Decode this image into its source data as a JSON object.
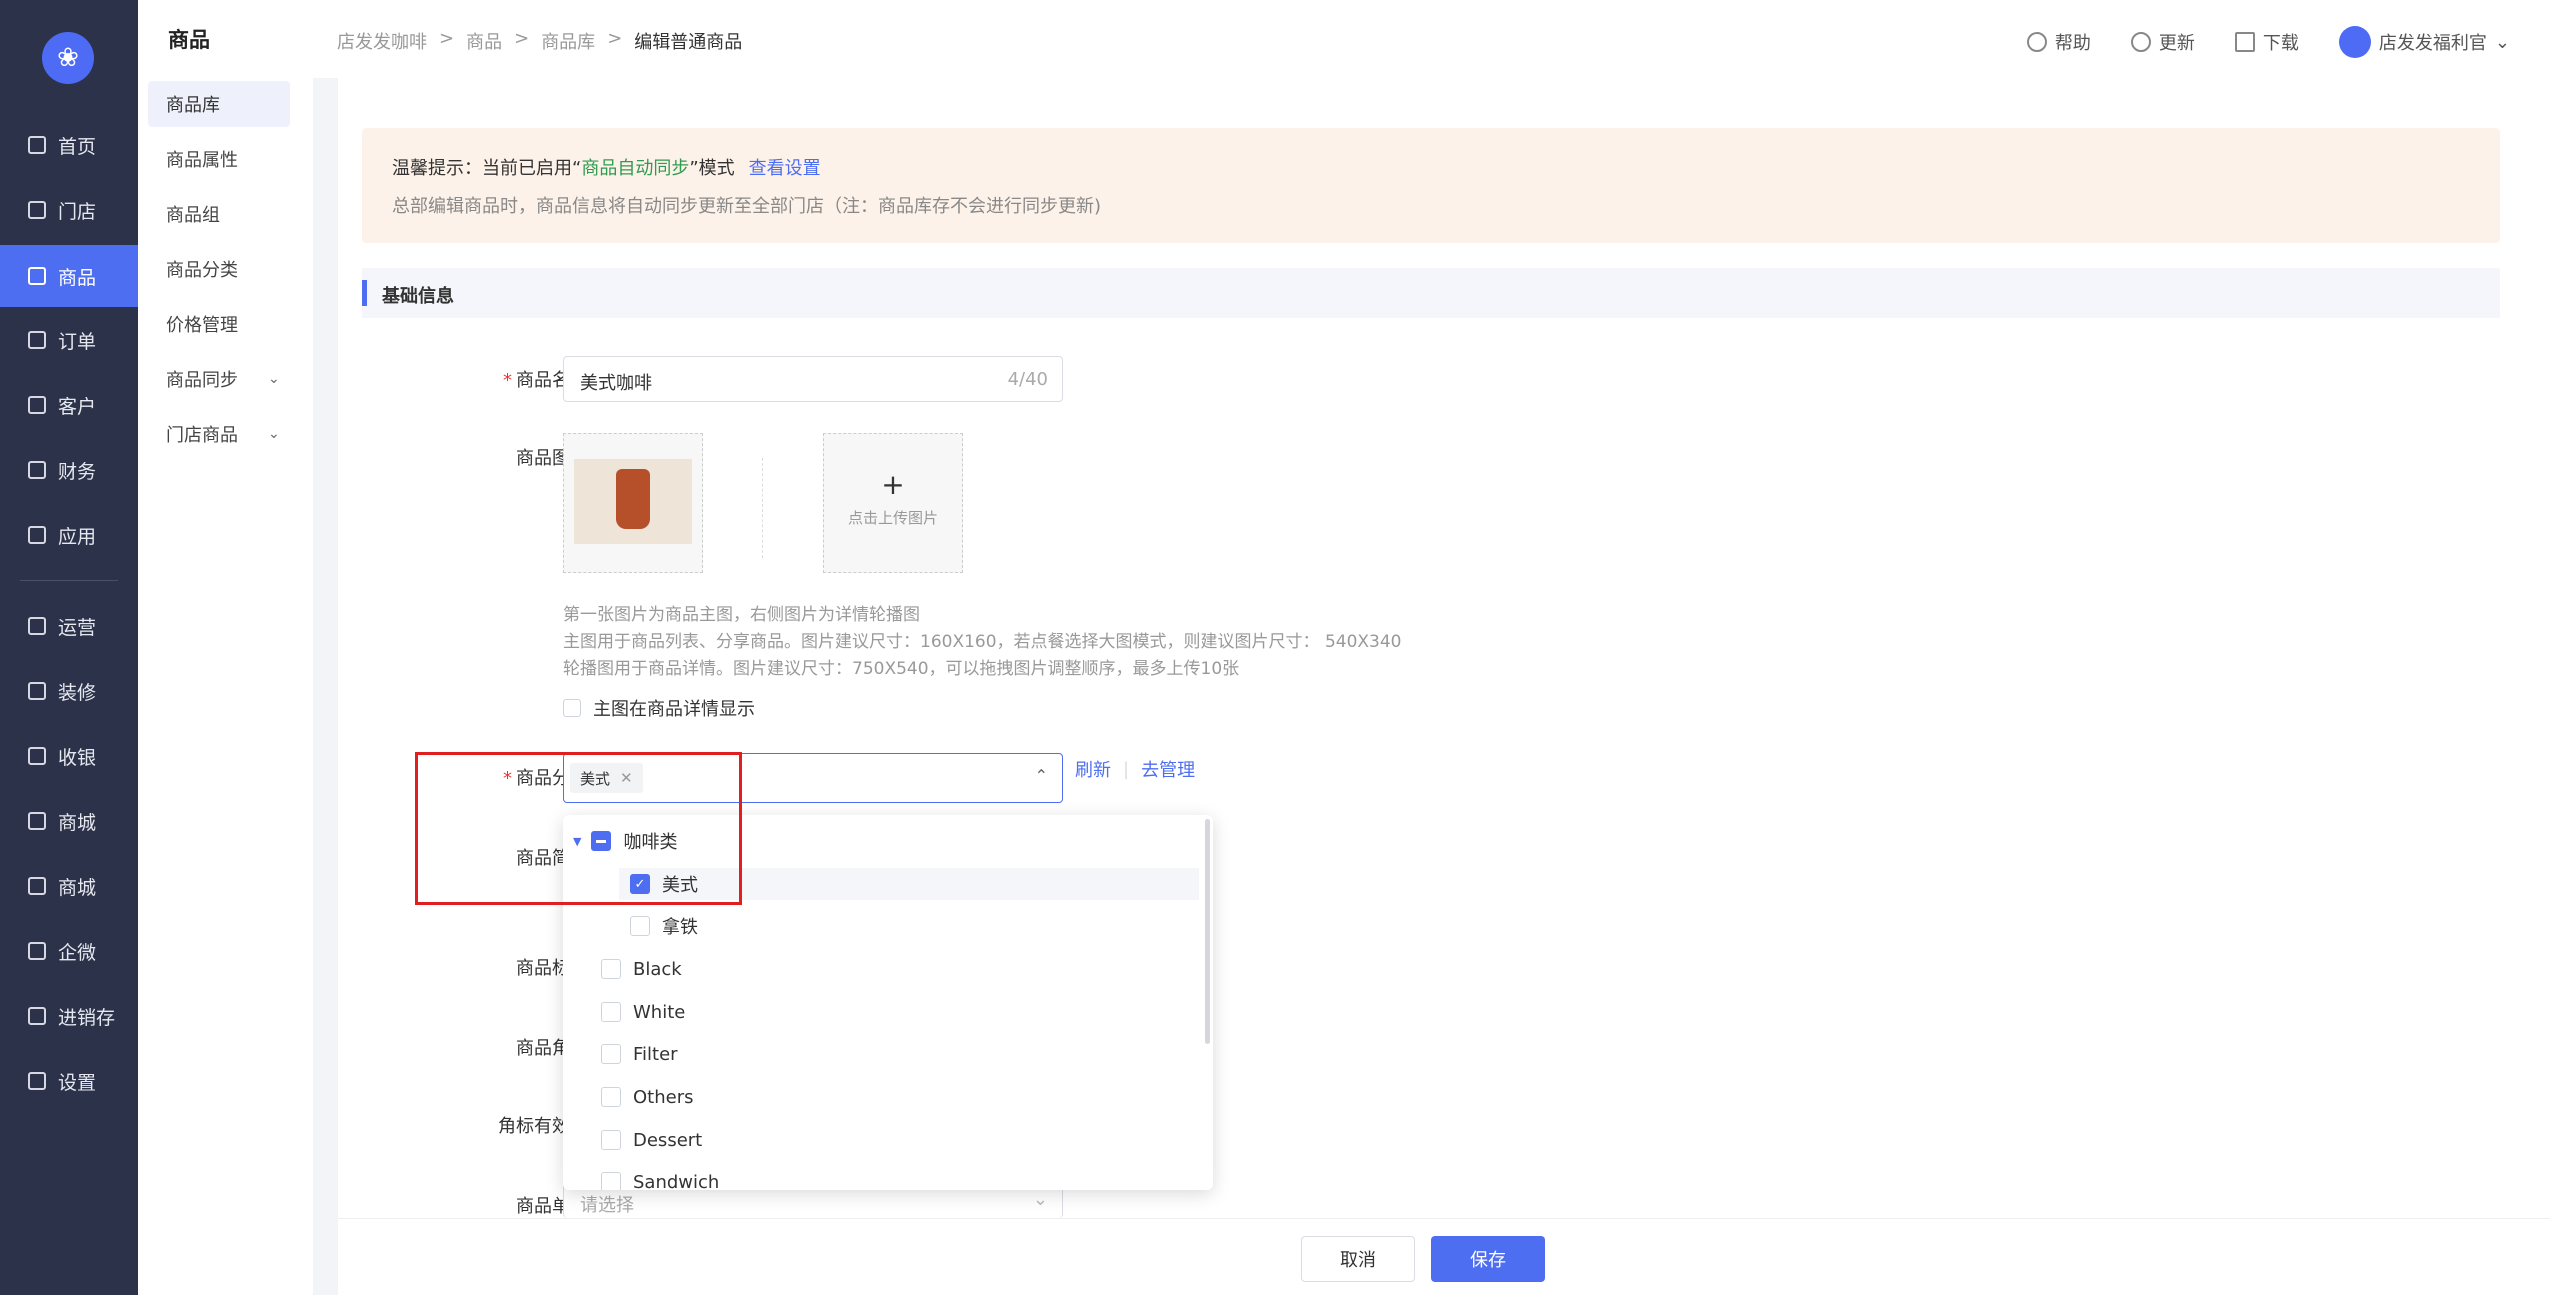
{
  "sidebar": {
    "logo_icon": "butterfly-logo",
    "items": [
      {
        "label": "首页",
        "icon": "home-icon"
      },
      {
        "label": "门店",
        "icon": "store-icon"
      },
      {
        "label": "商品",
        "icon": "bag-icon",
        "active": true
      },
      {
        "label": "订单",
        "icon": "order-icon"
      },
      {
        "label": "客户",
        "icon": "user-icon"
      },
      {
        "label": "财务",
        "icon": "wallet-icon"
      },
      {
        "label": "应用",
        "icon": "apps-icon"
      },
      {
        "label": "运营",
        "icon": "gift-icon"
      },
      {
        "label": "装修",
        "icon": "layers-icon"
      },
      {
        "label": "收银",
        "icon": "cashier-icon"
      },
      {
        "label": "商城",
        "icon": "mall-icon"
      },
      {
        "label": "商城",
        "icon": "mall-icon"
      },
      {
        "label": "企微",
        "icon": "chat-icon"
      },
      {
        "label": "进销存",
        "icon": "inventory-icon"
      },
      {
        "label": "设置",
        "icon": "settings-icon"
      }
    ]
  },
  "submenu": {
    "title": "商品",
    "items": [
      {
        "label": "商品库",
        "active": true
      },
      {
        "label": "商品属性"
      },
      {
        "label": "商品组"
      },
      {
        "label": "商品分类"
      },
      {
        "label": "价格管理"
      },
      {
        "label": "商品同步",
        "expandable": true
      },
      {
        "label": "门店商品",
        "expandable": true
      }
    ]
  },
  "header": {
    "breadcrumb": [
      "店发发咖啡",
      "商品",
      "商品库",
      "编辑普通商品"
    ],
    "help": "帮助",
    "update": "更新",
    "download": "下载",
    "user": "店发发福利官"
  },
  "tip": {
    "prefix": "温馨提示：当前已启用“",
    "highlight": "商品自动同步",
    "suffix": "”模式",
    "link": "查看设置",
    "line2": "总部编辑商品时，商品信息将自动同步更新至全部门店（注：商品库存不会进行同步更新)"
  },
  "section_title": "基础信息",
  "form": {
    "name_label": "商品名称",
    "name_value": "美式咖啡",
    "name_count": "4/40",
    "image_label": "商品图片",
    "upload_text": "点击上传图片",
    "image_hint1": "第一张图片为商品主图，右侧图片为详情轮播图",
    "image_hint2": "主图用于商品列表、分享商品。图片建议尺寸：160X160，若点餐选择大图模式，则建议图片尺寸： 540X340",
    "image_hint3": "轮播图用于商品详情。图片建议尺寸：750X540，可以拖拽图片调整顺序，最多上传10张",
    "show_main_image": "主图在商品详情显示",
    "category_label": "商品分类",
    "category_tag": "美式",
    "refresh": "刷新",
    "manage": "去管理",
    "intro_label": "商品简介",
    "tags_label": "商品标签",
    "badge_label": "商品角标",
    "badge_period_label": "角标有效期",
    "unit_label": "商品单位",
    "unit_placeholder": "请选择"
  },
  "dropdown": {
    "group": "咖啡类",
    "children": [
      {
        "label": "美式",
        "checked": true
      },
      {
        "label": "拿铁",
        "checked": false
      }
    ],
    "others": [
      "Black",
      "White",
      "Filter",
      "Others",
      "Dessert",
      "Sandwich"
    ]
  },
  "footer": {
    "cancel": "取消",
    "save": "保存"
  },
  "colors": {
    "primary": "#4e6ef2",
    "sidebar_bg": "#2c3249",
    "highlight_box": "#e02020",
    "tip_bg": "#fdf2e9",
    "tip_green": "#2e9b4e"
  }
}
